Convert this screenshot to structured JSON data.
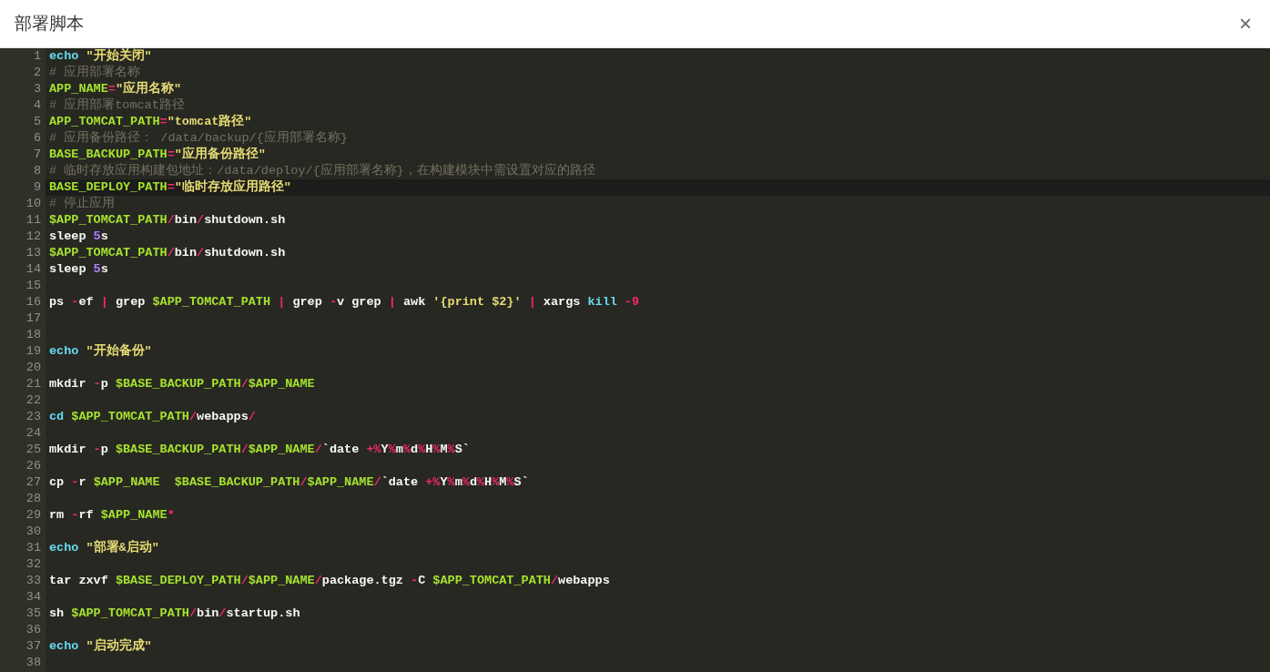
{
  "dialog": {
    "title": "部署脚本",
    "close": "×"
  },
  "editor": {
    "lines": [
      {
        "number": "1",
        "active": false,
        "tokens": [
          {
            "kind": "keyword",
            "text": "echo"
          },
          {
            "kind": "string",
            "text": " \"开始关闭\""
          }
        ]
      },
      {
        "number": "2",
        "active": false,
        "tokens": [
          {
            "kind": "comment",
            "text": "# 应用部署名称"
          }
        ]
      },
      {
        "number": "3",
        "active": false,
        "tokens": [
          {
            "kind": "variable",
            "text": "APP_NAME"
          },
          {
            "kind": "operator",
            "text": "="
          },
          {
            "kind": "string",
            "text": "\"应用名称\""
          }
        ]
      },
      {
        "number": "4",
        "active": false,
        "tokens": [
          {
            "kind": "comment",
            "text": "# 应用部署tomcat路径"
          }
        ]
      },
      {
        "number": "5",
        "active": false,
        "tokens": [
          {
            "kind": "variable",
            "text": "APP_TOMCAT_PATH"
          },
          {
            "kind": "operator",
            "text": "="
          },
          {
            "kind": "string",
            "text": "\"tomcat路径\""
          }
        ]
      },
      {
        "number": "6",
        "active": false,
        "tokens": [
          {
            "kind": "comment",
            "text": "# 应用备份路径： /data/backup/{应用部署名称}"
          }
        ]
      },
      {
        "number": "7",
        "active": false,
        "tokens": [
          {
            "kind": "variable",
            "text": "BASE_BACKUP_PATH"
          },
          {
            "kind": "operator",
            "text": "="
          },
          {
            "kind": "string",
            "text": "\"应用备份路径\""
          }
        ]
      },
      {
        "number": "8",
        "active": false,
        "tokens": [
          {
            "kind": "comment",
            "text": "# 临时存放应用构建包地址：/data/deploy/{应用部署名称}，在构建模块中需设置对应的路径"
          }
        ]
      },
      {
        "number": "9",
        "active": true,
        "tokens": [
          {
            "kind": "variable",
            "text": "BASE_DEPLOY_PATH"
          },
          {
            "kind": "operator",
            "text": "="
          },
          {
            "kind": "string",
            "text": "\"临时存放应用路径\""
          }
        ]
      },
      {
        "number": "10",
        "active": false,
        "tokens": [
          {
            "kind": "comment",
            "text": "# 停止应用"
          }
        ]
      },
      {
        "number": "11",
        "active": false,
        "tokens": [
          {
            "kind": "variable",
            "text": "$APP_TOMCAT_PATH"
          },
          {
            "kind": "operator",
            "text": "/"
          },
          {
            "kind": "text",
            "text": "bin"
          },
          {
            "kind": "operator",
            "text": "/"
          },
          {
            "kind": "text",
            "text": "shutdown.sh"
          }
        ]
      },
      {
        "number": "12",
        "active": false,
        "tokens": [
          {
            "kind": "text",
            "text": "sleep "
          },
          {
            "kind": "number",
            "text": "5"
          },
          {
            "kind": "text",
            "text": "s"
          }
        ]
      },
      {
        "number": "13",
        "active": false,
        "tokens": [
          {
            "kind": "variable",
            "text": "$APP_TOMCAT_PATH"
          },
          {
            "kind": "operator",
            "text": "/"
          },
          {
            "kind": "text",
            "text": "bin"
          },
          {
            "kind": "operator",
            "text": "/"
          },
          {
            "kind": "text",
            "text": "shutdown.sh"
          }
        ]
      },
      {
        "number": "14",
        "active": false,
        "tokens": [
          {
            "kind": "text",
            "text": "sleep "
          },
          {
            "kind": "number",
            "text": "5"
          },
          {
            "kind": "text",
            "text": "s"
          }
        ]
      },
      {
        "number": "15",
        "active": false
      },
      {
        "number": "16",
        "active": false,
        "tokens": [
          {
            "kind": "text",
            "text": "ps "
          },
          {
            "kind": "operator",
            "text": "-"
          },
          {
            "kind": "text",
            "text": "ef "
          },
          {
            "kind": "operator",
            "text": "|"
          },
          {
            "kind": "text",
            "text": " grep "
          },
          {
            "kind": "variable",
            "text": "$APP_TOMCAT_PATH"
          },
          {
            "kind": "operator",
            "text": " |"
          },
          {
            "kind": "text",
            "text": " grep "
          },
          {
            "kind": "operator",
            "text": "-"
          },
          {
            "kind": "text",
            "text": "v grep "
          },
          {
            "kind": "operator",
            "text": "|"
          },
          {
            "kind": "text",
            "text": " awk "
          },
          {
            "kind": "string",
            "text": "'{print $2}'"
          },
          {
            "kind": "operator",
            "text": " |"
          },
          {
            "kind": "text",
            "text": " xargs "
          },
          {
            "kind": "keyword",
            "text": "kill"
          },
          {
            "kind": "operator",
            "text": " -9"
          }
        ]
      },
      {
        "number": "17",
        "active": false
      },
      {
        "number": "18",
        "active": false
      },
      {
        "number": "19",
        "active": false,
        "tokens": [
          {
            "kind": "keyword",
            "text": "echo"
          },
          {
            "kind": "string",
            "text": " \"开始备份\""
          }
        ]
      },
      {
        "number": "20",
        "active": false
      },
      {
        "number": "21",
        "active": false,
        "tokens": [
          {
            "kind": "text",
            "text": "mkdir "
          },
          {
            "kind": "operator",
            "text": "-"
          },
          {
            "kind": "text",
            "text": "p "
          },
          {
            "kind": "variable",
            "text": "$BASE_BACKUP_PATH"
          },
          {
            "kind": "operator",
            "text": "/"
          },
          {
            "kind": "variable",
            "text": "$APP_NAME"
          }
        ]
      },
      {
        "number": "22",
        "active": false
      },
      {
        "number": "23",
        "active": false,
        "tokens": [
          {
            "kind": "keyword",
            "text": "cd"
          },
          {
            "kind": "variable",
            "text": " $APP_TOMCAT_PATH"
          },
          {
            "kind": "operator",
            "text": "/"
          },
          {
            "kind": "text",
            "text": "webapps"
          },
          {
            "kind": "operator",
            "text": "/"
          }
        ]
      },
      {
        "number": "24",
        "active": false
      },
      {
        "number": "25",
        "active": false,
        "tokens": [
          {
            "kind": "text",
            "text": "mkdir "
          },
          {
            "kind": "operator",
            "text": "-"
          },
          {
            "kind": "text",
            "text": "p "
          },
          {
            "kind": "variable",
            "text": "$BASE_BACKUP_PATH"
          },
          {
            "kind": "operator",
            "text": "/"
          },
          {
            "kind": "variable",
            "text": "$APP_NAME"
          },
          {
            "kind": "operator",
            "text": "/"
          },
          {
            "kind": "text",
            "text": "`date "
          },
          {
            "kind": "operator",
            "text": "+%"
          },
          {
            "kind": "text",
            "text": "Y"
          },
          {
            "kind": "operator",
            "text": "%"
          },
          {
            "kind": "text",
            "text": "m"
          },
          {
            "kind": "operator",
            "text": "%"
          },
          {
            "kind": "text",
            "text": "d"
          },
          {
            "kind": "operator",
            "text": "%"
          },
          {
            "kind": "text",
            "text": "H"
          },
          {
            "kind": "operator",
            "text": "%"
          },
          {
            "kind": "text",
            "text": "M"
          },
          {
            "kind": "operator",
            "text": "%"
          },
          {
            "kind": "text",
            "text": "S`"
          }
        ]
      },
      {
        "number": "26",
        "active": false
      },
      {
        "number": "27",
        "active": false,
        "tokens": [
          {
            "kind": "text",
            "text": "cp "
          },
          {
            "kind": "operator",
            "text": "-"
          },
          {
            "kind": "text",
            "text": "r "
          },
          {
            "kind": "variable",
            "text": "$APP_NAME"
          },
          {
            "kind": "variable",
            "text": "  $BASE_BACKUP_PATH"
          },
          {
            "kind": "operator",
            "text": "/"
          },
          {
            "kind": "variable",
            "text": "$APP_NAME"
          },
          {
            "kind": "operator",
            "text": "/"
          },
          {
            "kind": "text",
            "text": "`date "
          },
          {
            "kind": "operator",
            "text": "+%"
          },
          {
            "kind": "text",
            "text": "Y"
          },
          {
            "kind": "operator",
            "text": "%"
          },
          {
            "kind": "text",
            "text": "m"
          },
          {
            "kind": "operator",
            "text": "%"
          },
          {
            "kind": "text",
            "text": "d"
          },
          {
            "kind": "operator",
            "text": "%"
          },
          {
            "kind": "text",
            "text": "H"
          },
          {
            "kind": "operator",
            "text": "%"
          },
          {
            "kind": "text",
            "text": "M"
          },
          {
            "kind": "operator",
            "text": "%"
          },
          {
            "kind": "text",
            "text": "S`"
          }
        ]
      },
      {
        "number": "28",
        "active": false
      },
      {
        "number": "29",
        "active": false,
        "tokens": [
          {
            "kind": "text",
            "text": "rm "
          },
          {
            "kind": "operator",
            "text": "-"
          },
          {
            "kind": "text",
            "text": "rf "
          },
          {
            "kind": "variable",
            "text": "$APP_NAME"
          },
          {
            "kind": "operator",
            "text": "*"
          }
        ]
      },
      {
        "number": "30",
        "active": false
      },
      {
        "number": "31",
        "active": false,
        "tokens": [
          {
            "kind": "keyword",
            "text": "echo"
          },
          {
            "kind": "string",
            "text": " \"部署&启动\""
          }
        ]
      },
      {
        "number": "32",
        "active": false
      },
      {
        "number": "33",
        "active": false,
        "tokens": [
          {
            "kind": "text",
            "text": "tar zxvf "
          },
          {
            "kind": "variable",
            "text": "$BASE_DEPLOY_PATH"
          },
          {
            "kind": "operator",
            "text": "/"
          },
          {
            "kind": "variable",
            "text": "$APP_NAME"
          },
          {
            "kind": "operator",
            "text": "/"
          },
          {
            "kind": "text",
            "text": "package.tgz "
          },
          {
            "kind": "operator",
            "text": "-"
          },
          {
            "kind": "text",
            "text": "C "
          },
          {
            "kind": "variable",
            "text": "$APP_TOMCAT_PATH"
          },
          {
            "kind": "operator",
            "text": "/"
          },
          {
            "kind": "text",
            "text": "webapps"
          }
        ]
      },
      {
        "number": "34",
        "active": false
      },
      {
        "number": "35",
        "active": false,
        "tokens": [
          {
            "kind": "text",
            "text": "sh "
          },
          {
            "kind": "variable",
            "text": "$APP_TOMCAT_PATH"
          },
          {
            "kind": "operator",
            "text": "/"
          },
          {
            "kind": "text",
            "text": "bin"
          },
          {
            "kind": "operator",
            "text": "/"
          },
          {
            "kind": "text",
            "text": "startup.sh"
          }
        ]
      },
      {
        "number": "36",
        "active": false
      },
      {
        "number": "37",
        "active": false,
        "tokens": [
          {
            "kind": "keyword",
            "text": "echo"
          },
          {
            "kind": "string",
            "text": " \"启动完成\""
          }
        ]
      },
      {
        "number": "38",
        "active": false
      }
    ]
  }
}
